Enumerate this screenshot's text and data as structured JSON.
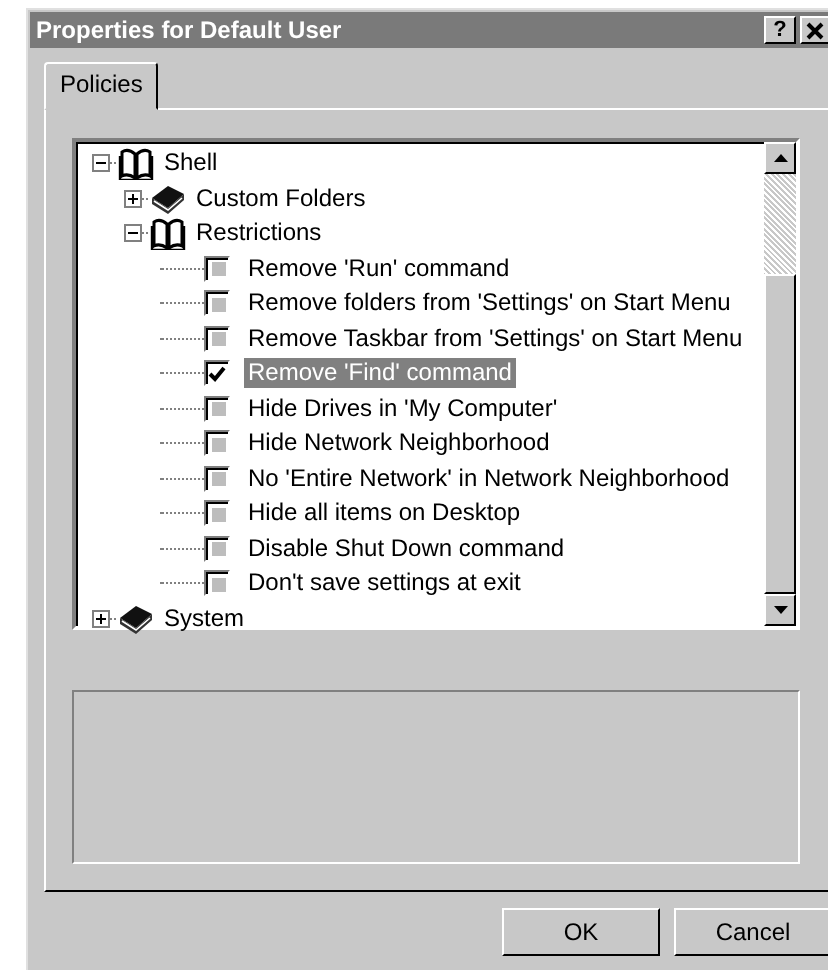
{
  "window": {
    "title": "Properties for Default User",
    "help_button": "?"
  },
  "tabs": [
    {
      "label": "Policies",
      "selected": true
    }
  ],
  "tree": [
    {
      "label": "Shell",
      "kind": "category",
      "expanded": true,
      "selected": false,
      "children": [
        {
          "label": "Custom Folders",
          "kind": "category",
          "expanded": false,
          "selected": false
        },
        {
          "label": "Restrictions",
          "kind": "category",
          "expanded": true,
          "selected": false,
          "children": [
            {
              "label": "Remove 'Run' command",
              "kind": "policy",
              "checked": false,
              "indeterminate": true,
              "selected": false
            },
            {
              "label": "Remove folders from 'Settings' on Start Menu",
              "kind": "policy",
              "checked": false,
              "indeterminate": true,
              "selected": false
            },
            {
              "label": "Remove Taskbar from 'Settings' on Start Menu",
              "kind": "policy",
              "checked": false,
              "indeterminate": true,
              "selected": false
            },
            {
              "label": "Remove 'Find' command",
              "kind": "policy",
              "checked": true,
              "indeterminate": false,
              "selected": true
            },
            {
              "label": "Hide Drives in 'My Computer'",
              "kind": "policy",
              "checked": false,
              "indeterminate": true,
              "selected": false
            },
            {
              "label": "Hide Network Neighborhood",
              "kind": "policy",
              "checked": false,
              "indeterminate": true,
              "selected": false
            },
            {
              "label": "No 'Entire Network' in Network Neighborhood",
              "kind": "policy",
              "checked": false,
              "indeterminate": true,
              "selected": false
            },
            {
              "label": "Hide all items on Desktop",
              "kind": "policy",
              "checked": false,
              "indeterminate": true,
              "selected": false
            },
            {
              "label": "Disable Shut Down command",
              "kind": "policy",
              "checked": false,
              "indeterminate": true,
              "selected": false
            },
            {
              "label": "Don't save settings at exit",
              "kind": "policy",
              "checked": false,
              "indeterminate": true,
              "selected": false
            }
          ]
        }
      ]
    },
    {
      "label": "System",
      "kind": "category",
      "expanded": false,
      "selected": false
    }
  ],
  "buttons": [
    "OK",
    "Cancel"
  ]
}
